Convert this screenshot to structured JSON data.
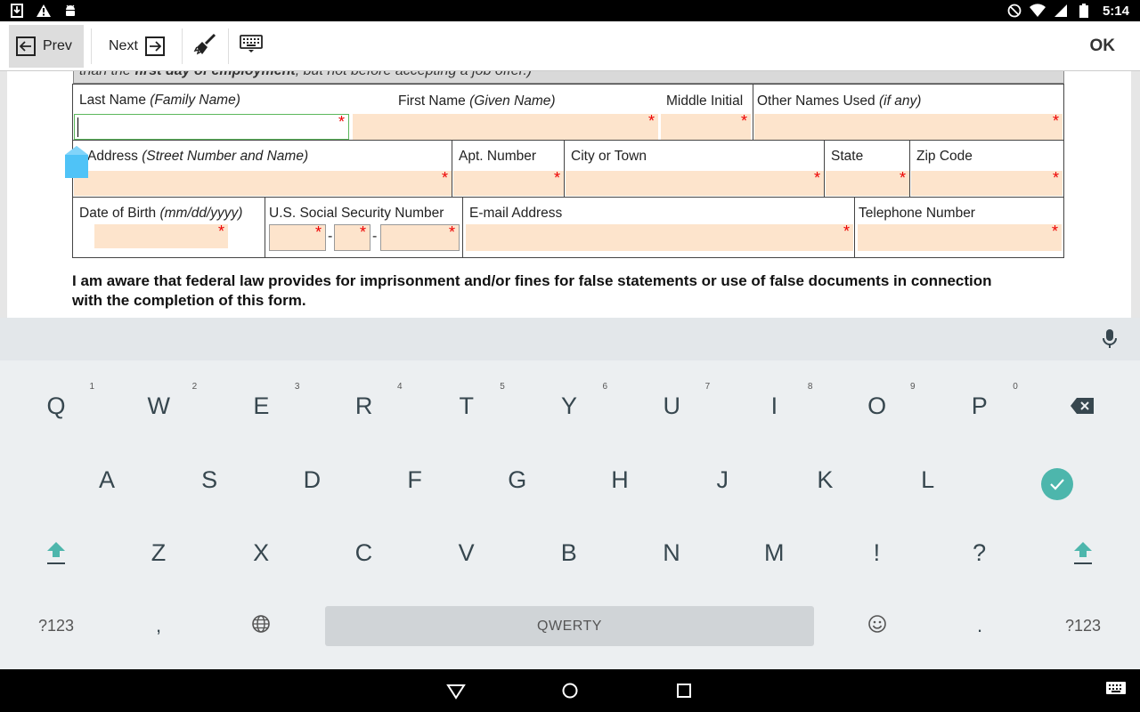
{
  "status_bar": {
    "time": "5:14",
    "icons_left": [
      "download-icon",
      "warning-icon",
      "android-icon"
    ],
    "icons_right": [
      "do-not-disturb-icon",
      "wifi-icon",
      "signal-icon",
      "battery-icon"
    ]
  },
  "toolbar": {
    "prev_label": "Prev",
    "next_label": "Next",
    "ok_label": "OK"
  },
  "form": {
    "header_text_pre": "than the ",
    "header_text_bold": "first day of employment",
    "header_text_post": ", but not before accepting a job offer.)",
    "row1": {
      "last_name_label": "Last Name",
      "last_name_hint": "(Family Name)",
      "first_name_label": "First Name",
      "first_name_hint": "(Given Name)",
      "middle_initial_label": "Middle Initial",
      "other_names_label": "Other Names Used",
      "other_names_hint": "(if any)"
    },
    "row2": {
      "address_label": "Address",
      "address_hint": "(Street Number and Name)",
      "apt_label": "Apt. Number",
      "city_label": "City or Town",
      "state_label": "State",
      "zip_label": "Zip Code"
    },
    "row3": {
      "dob_label": "Date of Birth",
      "dob_hint": "(mm/dd/yyyy)",
      "ssn_label": "U.S. Social Security Number",
      "email_label": "E-mail Address",
      "phone_label": "Telephone Number"
    },
    "required_mark": "*",
    "ssn_separator": "-",
    "notice": "I am aware that federal law provides for imprisonment and/or fines for false statements or use of false documents in connection with the completion of this form."
  },
  "keyboard": {
    "row1": [
      {
        "key": "Q",
        "hint": "1"
      },
      {
        "key": "W",
        "hint": "2"
      },
      {
        "key": "E",
        "hint": "3"
      },
      {
        "key": "R",
        "hint": "4"
      },
      {
        "key": "T",
        "hint": "5"
      },
      {
        "key": "Y",
        "hint": "6"
      },
      {
        "key": "U",
        "hint": "7"
      },
      {
        "key": "I",
        "hint": "8"
      },
      {
        "key": "O",
        "hint": "9"
      },
      {
        "key": "P",
        "hint": "0"
      }
    ],
    "row2": [
      "A",
      "S",
      "D",
      "F",
      "G",
      "H",
      "J",
      "K",
      "L"
    ],
    "row3": [
      "Z",
      "X",
      "C",
      "V",
      "B",
      "N",
      "M",
      "!",
      "?"
    ],
    "symbols_label": "?123",
    "comma_label": ",",
    "period_label": ".",
    "space_label": "QWERTY",
    "accent_color": "#4db6ac"
  }
}
